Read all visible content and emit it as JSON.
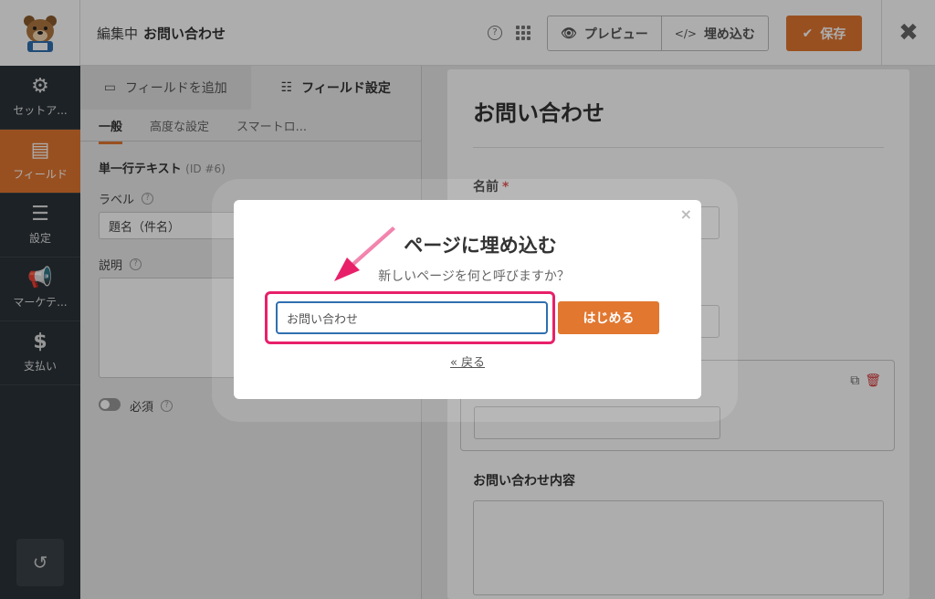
{
  "header": {
    "editing_label": "編集中",
    "form_name": "お問い合わせ",
    "preview_label": "プレビュー",
    "embed_label": "埋め込む",
    "save_label": "保存"
  },
  "leftnav": {
    "items": [
      {
        "label": "セットア..."
      },
      {
        "label": "フィールド"
      },
      {
        "label": "設定"
      },
      {
        "label": "マーケテ..."
      },
      {
        "label": "支払い"
      }
    ]
  },
  "panel": {
    "tabs": [
      {
        "label": "フィールドを追加"
      },
      {
        "label": "フィールド設定"
      }
    ],
    "subtabs": [
      "一般",
      "高度な設定",
      "スマートロ..."
    ],
    "field_type": "単一行テキスト",
    "field_id": "(ID #6)",
    "label_label": "ラベル",
    "label_value": "題名（件名）",
    "description_label": "説明",
    "required_label": "必須"
  },
  "preview": {
    "title": "お問い合わせ",
    "name_label": "名前",
    "message_label": "お問い合わせ内容"
  },
  "modal": {
    "title": "ページに埋め込む",
    "subtitle": "新しいページを何と呼びますか？",
    "input_value": "お問い合わせ",
    "start_label": "はじめる",
    "back_label": "« 戻る",
    "close_glyph": "×"
  },
  "colors": {
    "accent": "#e27730",
    "sidebar": "#2c3338",
    "highlight": "#e8206a",
    "arrow": "#e8206a",
    "input_border": "#2f6fb0"
  }
}
